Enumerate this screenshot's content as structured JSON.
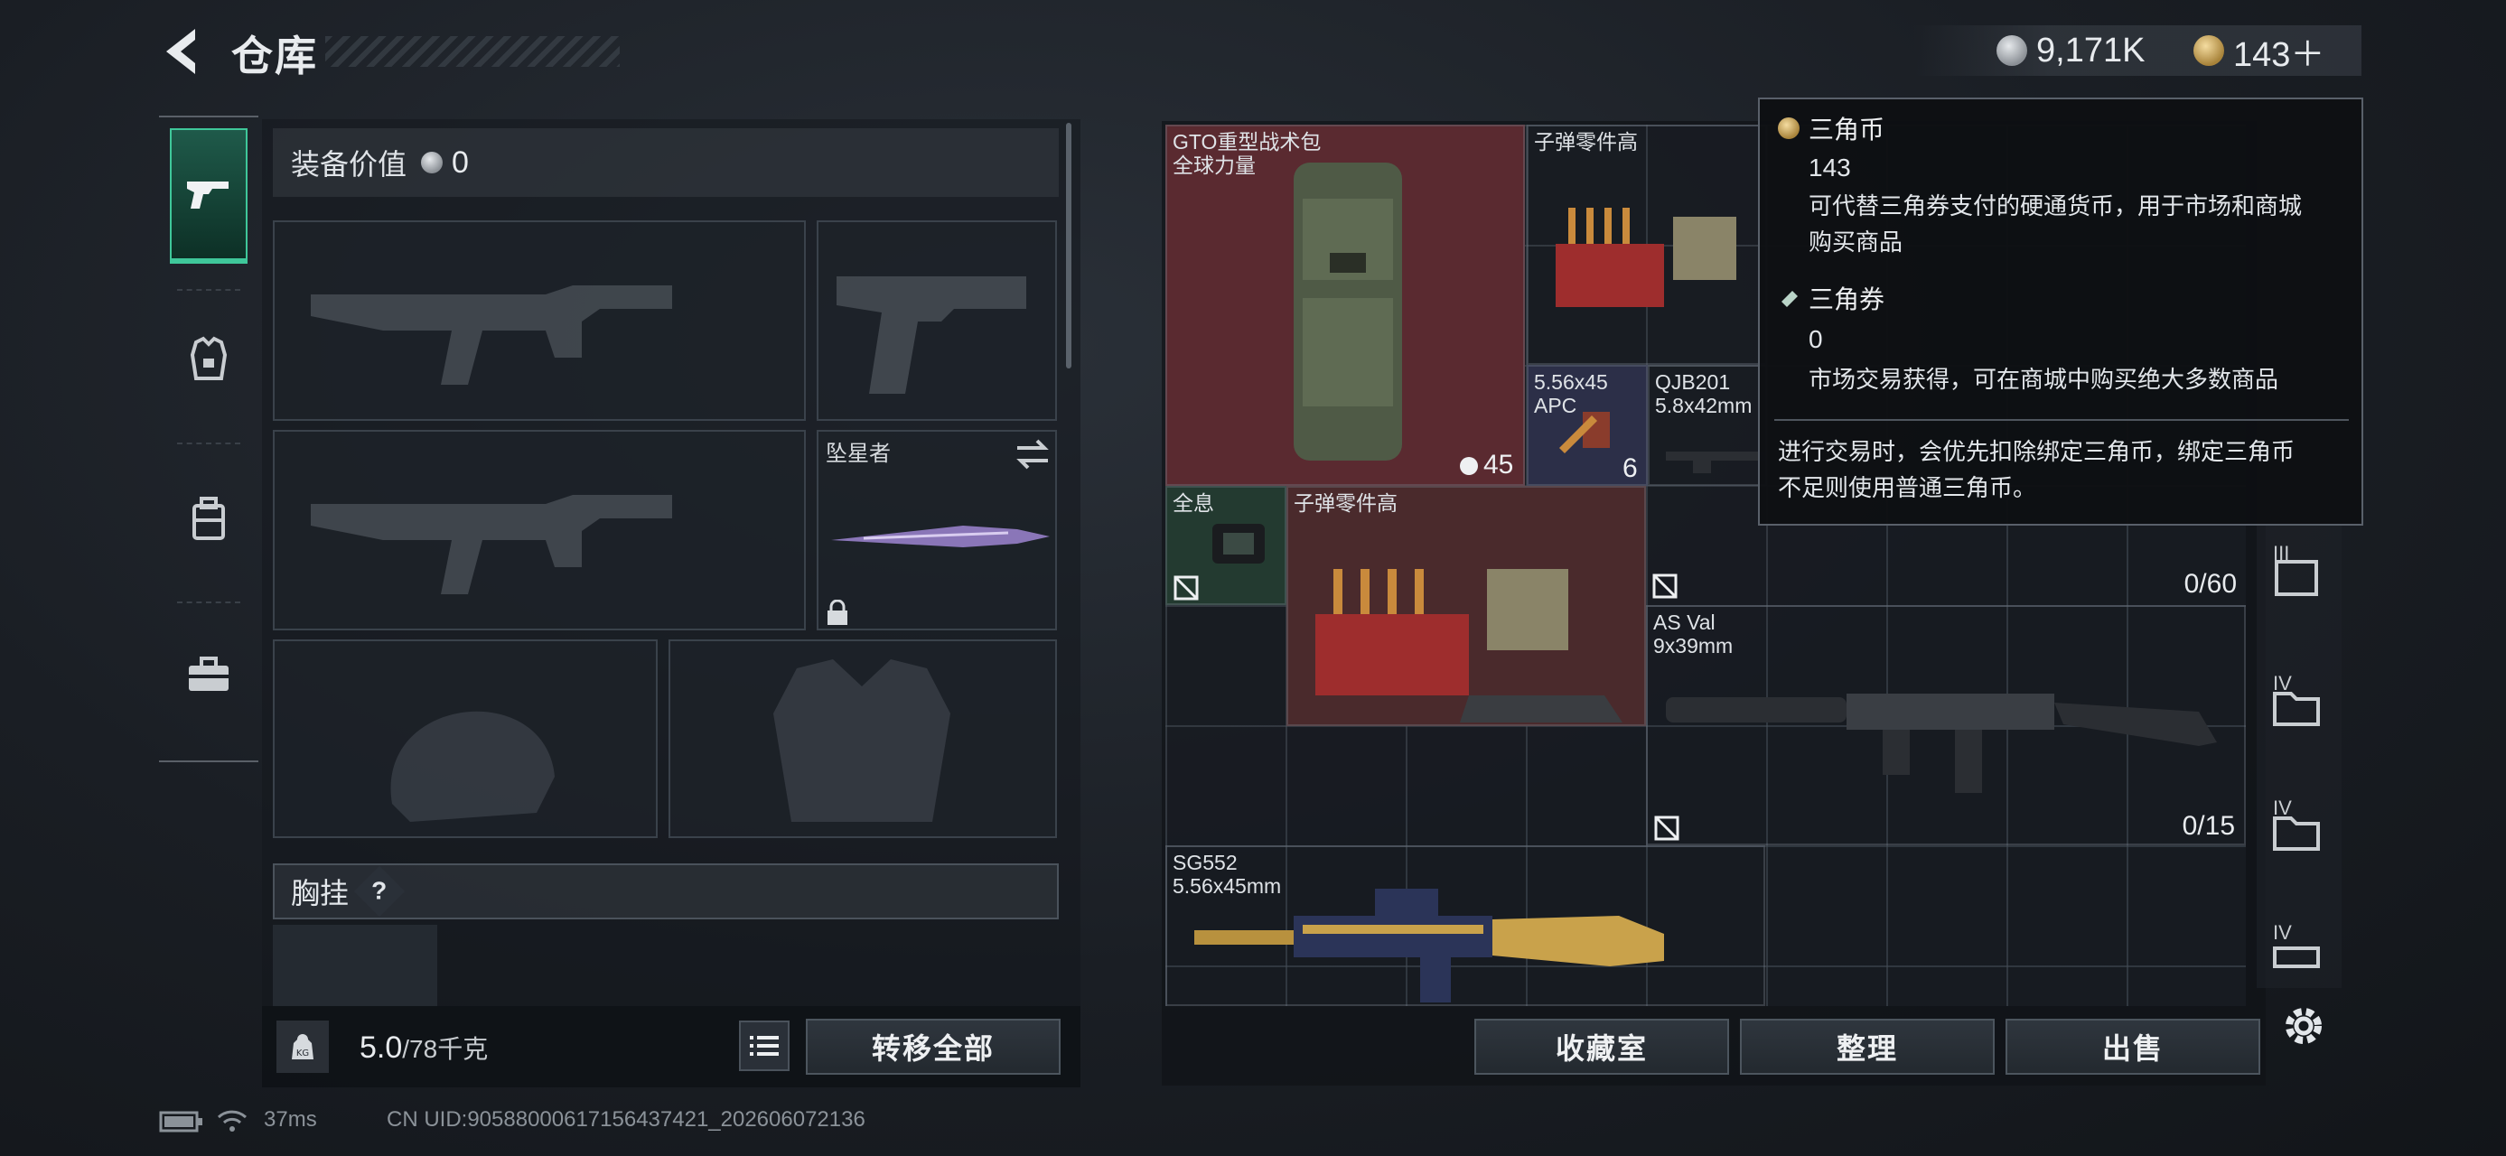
{
  "header": {
    "title": "仓库",
    "currencies": [
      {
        "name": "silver-coin-icon",
        "value": "9,171K"
      },
      {
        "name": "triangle-coin-icon",
        "value": "143＋"
      }
    ]
  },
  "equipment": {
    "value_label": "装备价值",
    "value": "0",
    "melee_name": "坠星者",
    "chest_label": "胸挂",
    "help": "?",
    "weight": "5.0",
    "weight_max": "/78千克",
    "kg_badge": "KG",
    "transfer_all": "转移全部"
  },
  "warehouse": {
    "items": [
      {
        "name": "GTO重型战术包\n全球力量",
        "count": "45"
      },
      {
        "name": "子弹零件高"
      },
      {
        "name": "5.56x45\nAPC",
        "count": "6"
      },
      {
        "name": "QJB201\n5.8x42mm"
      },
      {
        "name": "全息"
      },
      {
        "name": "子弹零件高"
      },
      {
        "name": "AS Val\n9x39mm"
      },
      {
        "name": "SG552\n5.56x45mm"
      }
    ],
    "capacity_1": "0/60",
    "capacity_2": "0/15",
    "tier_labels": [
      "III",
      "IV",
      "IV",
      "IV"
    ]
  },
  "bottom_buttons": {
    "collection": "收藏室",
    "sort": "整理",
    "sell": "出售"
  },
  "tooltip": {
    "coin_title": "三角币",
    "coin_value": "143",
    "coin_desc_1": "可代替三角券支付的硬通货币，用于市场和商城",
    "coin_desc_2": "购买商品",
    "ticket_title": "三角券",
    "ticket_value": "0",
    "ticket_desc": "市场交易获得，可在商城中购买绝大多数商品",
    "note_1": "进行交易时，会优先扣除绑定三角币，绑定三角币",
    "note_2": "不足则使用普通三角币。"
  },
  "status": {
    "ping": "37ms",
    "uid": "CN UID:9058800061715643742​1_202606072136"
  },
  "colors": {
    "accent_green": "#3fc79a",
    "backpack_red": "#5a2a30",
    "gold_coin": "#c9a24b"
  }
}
